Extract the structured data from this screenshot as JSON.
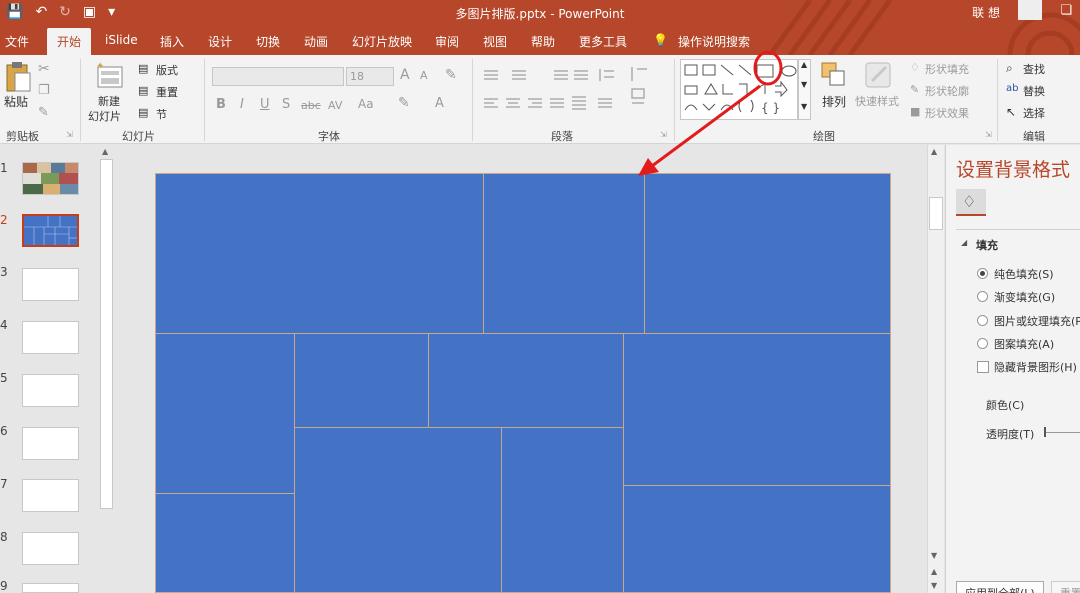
{
  "title_bar": {
    "document_title": "多图片排版.pptx - PowerPoint",
    "user_name": "联 想",
    "icons": [
      "save-icon",
      "undo-icon",
      "redo-icon",
      "slideshow-icon",
      "dropdown-icon",
      "restore-icon"
    ]
  },
  "tabs": [
    "文件",
    "开始",
    "iSlide",
    "插入",
    "设计",
    "切换",
    "动画",
    "幻灯片放映",
    "审阅",
    "视图",
    "帮助",
    "更多工具",
    "操作说明搜索"
  ],
  "active_tab": "开始",
  "ribbon": {
    "clipboard": {
      "paste": "粘贴",
      "group": "剪贴板"
    },
    "slides": {
      "new_slide_line1": "新建",
      "new_slide_line2": "幻灯片",
      "layout": "版式",
      "reset": "重置",
      "section": "节",
      "group": "幻灯片"
    },
    "font": {
      "size": "18",
      "group": "字体",
      "bold": "B",
      "italic": "I",
      "underline": "U",
      "shadow": "S",
      "strike": "abc",
      "spacing": "AV",
      "case": "Aa",
      "grow": "A",
      "shrink": "A",
      "color": "A"
    },
    "paragraph": {
      "group": "段落"
    },
    "drawing": {
      "arrange": "排列",
      "quick_styles": "快速样式",
      "shape_fill": "形状填充",
      "shape_outline": "形状轮廓",
      "shape_effect": "形状效果",
      "group": "绘图"
    },
    "editing": {
      "find": "查找",
      "replace": "替换",
      "select": "选择",
      "group": "编辑"
    }
  },
  "thumbnails": [
    "1",
    "2",
    "3",
    "4",
    "5",
    "6",
    "7",
    "8",
    "9"
  ],
  "active_slide": "2",
  "format_pane": {
    "title": "设置背景格式",
    "section": "填充",
    "options": [
      "纯色填充(S)",
      "渐变填充(G)",
      "图片或纹理填充(P)",
      "图案填充(A)"
    ],
    "selected_option": "纯色填充(S)",
    "checkbox": "隐藏背景图形(H)",
    "color_label": "颜色(C)",
    "transparency_label": "透明度(T)",
    "apply_all": "应用到全部(L)",
    "reset": "重置"
  },
  "colors": {
    "accent": "#b7472a",
    "slide_fill": "#4472c4",
    "annotation": "#e31b1b"
  }
}
